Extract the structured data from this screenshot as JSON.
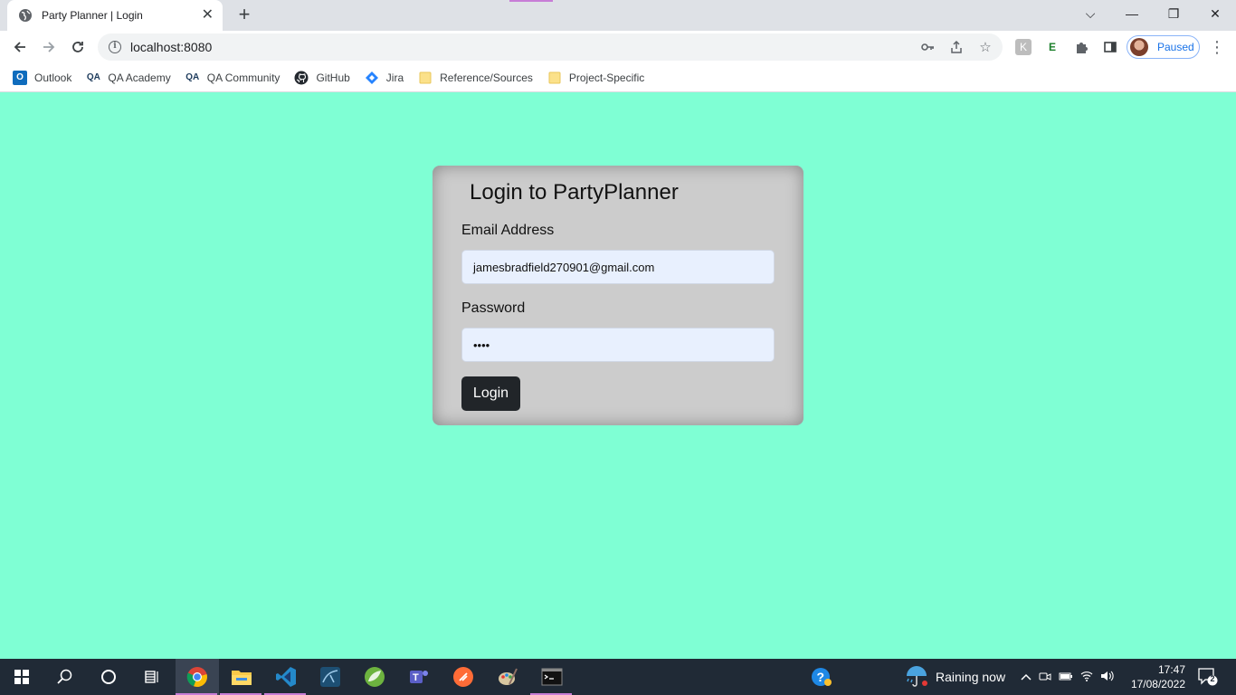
{
  "browser": {
    "tab_title": "Party Planner | Login",
    "tab_close": "✕",
    "new_tab": "+",
    "url": "localhost:8080",
    "profile_status": "Paused",
    "window_controls": {
      "dropdown": "⌵",
      "minimize": "—",
      "restore": "❐",
      "close": "✕"
    },
    "bookmarks": [
      {
        "label": "Outlook",
        "icon": "outlook-icon"
      },
      {
        "label": "QA Academy",
        "icon": "qa-icon"
      },
      {
        "label": "QA Community",
        "icon": "qa-icon"
      },
      {
        "label": "GitHub",
        "icon": "github-icon"
      },
      {
        "label": "Jira",
        "icon": "jira-icon"
      },
      {
        "label": "Reference/Sources",
        "icon": "folder-icon"
      },
      {
        "label": "Project-Specific",
        "icon": "folder-icon"
      }
    ]
  },
  "login": {
    "heading": "Login to PartyPlanner",
    "email_label": "Email Address",
    "email_value": "jamesbradfield270901@gmail.com",
    "password_label": "Password",
    "password_value": "••••",
    "button_label": "Login"
  },
  "taskbar": {
    "weather": "Raining now",
    "time": "17:47",
    "date": "17/08/2022",
    "notification_count": "2"
  },
  "colors": {
    "page_background": "#7fffd4",
    "card_background": "#cccccc",
    "input_background": "#e8f0fe",
    "button_background": "#212529"
  }
}
